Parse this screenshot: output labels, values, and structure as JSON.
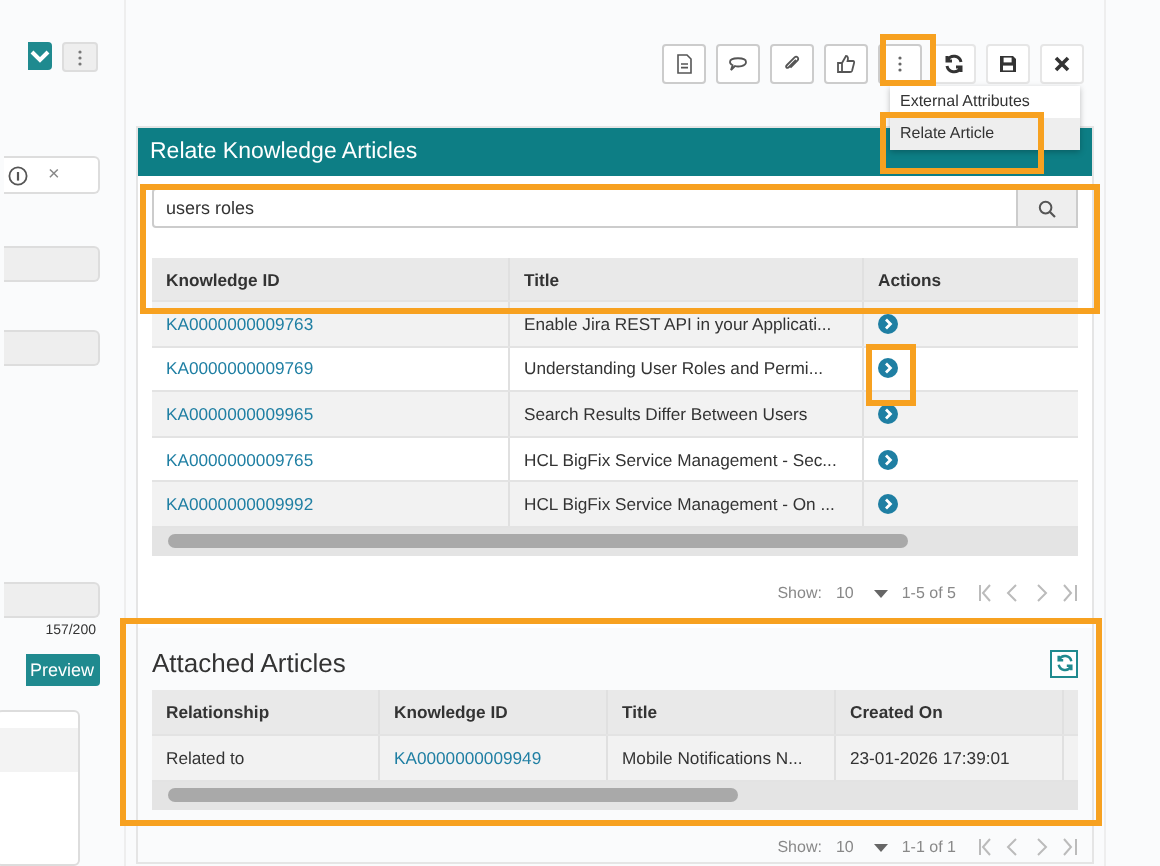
{
  "left_panel": {
    "close_glyph": "×",
    "counter": "157/200",
    "preview_button": "Preview"
  },
  "menu": {
    "items": [
      {
        "label": "External Attributes",
        "selected": false
      },
      {
        "label": "Relate Article",
        "selected": true
      }
    ]
  },
  "dialog": {
    "title": "Relate Knowledge Articles",
    "search": {
      "value": "users roles"
    },
    "table": {
      "columns": [
        "Knowledge ID",
        "Title",
        "Actions"
      ],
      "rows": [
        {
          "id": "KA0000000009763",
          "title": "Enable Jira REST API in your Applicati..."
        },
        {
          "id": "KA0000000009769",
          "title": "Understanding User Roles and Permi..."
        },
        {
          "id": "KA0000000009965",
          "title": "Search Results Differ Between Users"
        },
        {
          "id": "KA0000000009765",
          "title": "HCL BigFix Service Management - Sec..."
        },
        {
          "id": "KA0000000009992",
          "title": "HCL BigFix Service Management - On ..."
        }
      ]
    },
    "pager": {
      "show_label": "Show:",
      "page_size": "10",
      "range": "1-5 of 5"
    }
  },
  "attached": {
    "title": "Attached Articles",
    "table": {
      "columns": [
        "Relationship",
        "Knowledge ID",
        "Title",
        "Created On"
      ],
      "rows": [
        {
          "relationship": "Related to",
          "id": "KA0000000009949",
          "title": "Mobile Notifications N...",
          "created_on": "23-01-2026 17:39:01"
        }
      ]
    },
    "pager": {
      "show_label": "Show:",
      "page_size": "10",
      "range": "1-1 of 1"
    }
  }
}
